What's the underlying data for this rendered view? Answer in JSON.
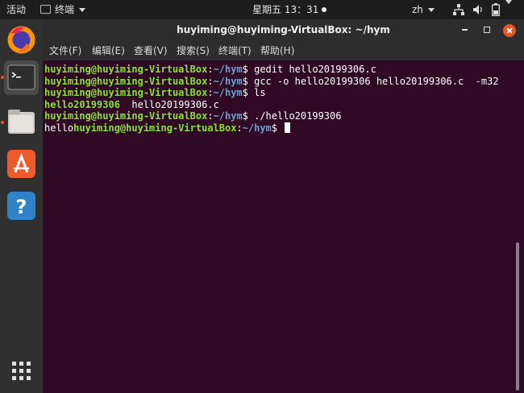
{
  "topbar": {
    "activities": "活动",
    "app_menu": "终端",
    "clock": "星期五 13：31",
    "language": "zh",
    "icons": [
      "network-icon",
      "volume-icon",
      "battery-icon"
    ]
  },
  "dock": {
    "items": [
      {
        "name": "firefox",
        "icon": "firefox-icon",
        "running": false
      },
      {
        "name": "terminal",
        "icon": "terminal-icon",
        "running": true,
        "active": true
      },
      {
        "name": "files",
        "icon": "files-icon",
        "running": true
      },
      {
        "name": "ubuntu-software",
        "icon": "software-icon",
        "running": false
      },
      {
        "name": "help",
        "icon": "help-icon",
        "label": "?",
        "running": false
      }
    ],
    "apps_grid_icon": "apps-grid-icon"
  },
  "window": {
    "title": "huyiming@huyiming-VirtualBox: ~/hym",
    "menu": [
      "文件(F)",
      "编辑(E)",
      "查看(V)",
      "搜索(S)",
      "终端(T)",
      "帮助(H)"
    ]
  },
  "terminal": {
    "lines": [
      {
        "user": "huyiming@huyiming-VirtualBox",
        "sep": ":",
        "path": "~/hym",
        "prompt": "$ ",
        "cmd": "gedit hello20199306.c"
      },
      {
        "user": "huyiming@huyiming-VirtualBox",
        "sep": ":",
        "path": "~/hym",
        "prompt": "$ ",
        "cmd": "gcc -o hello20199306 hello20199306.c  -m32"
      },
      {
        "user": "huyiming@huyiming-VirtualBox",
        "sep": ":",
        "path": "~/hym",
        "prompt": "$ ",
        "cmd": "ls"
      },
      {
        "exec": "hello20199306",
        "plain": "  hello20199306.c"
      },
      {
        "user": "huyiming@huyiming-VirtualBox",
        "sep": ":",
        "path": "~/hym",
        "prompt": "$ ",
        "cmd": "./hello20199306"
      },
      {
        "output": "hello",
        "user": "huyiming@huyiming-VirtualBox",
        "sep": ":",
        "path": "~/hym",
        "prompt": "$ "
      }
    ]
  },
  "colors": {
    "terminal_bg": "#300a24",
    "user": "#8ae234",
    "path": "#729fcf",
    "accent": "#e95420"
  }
}
